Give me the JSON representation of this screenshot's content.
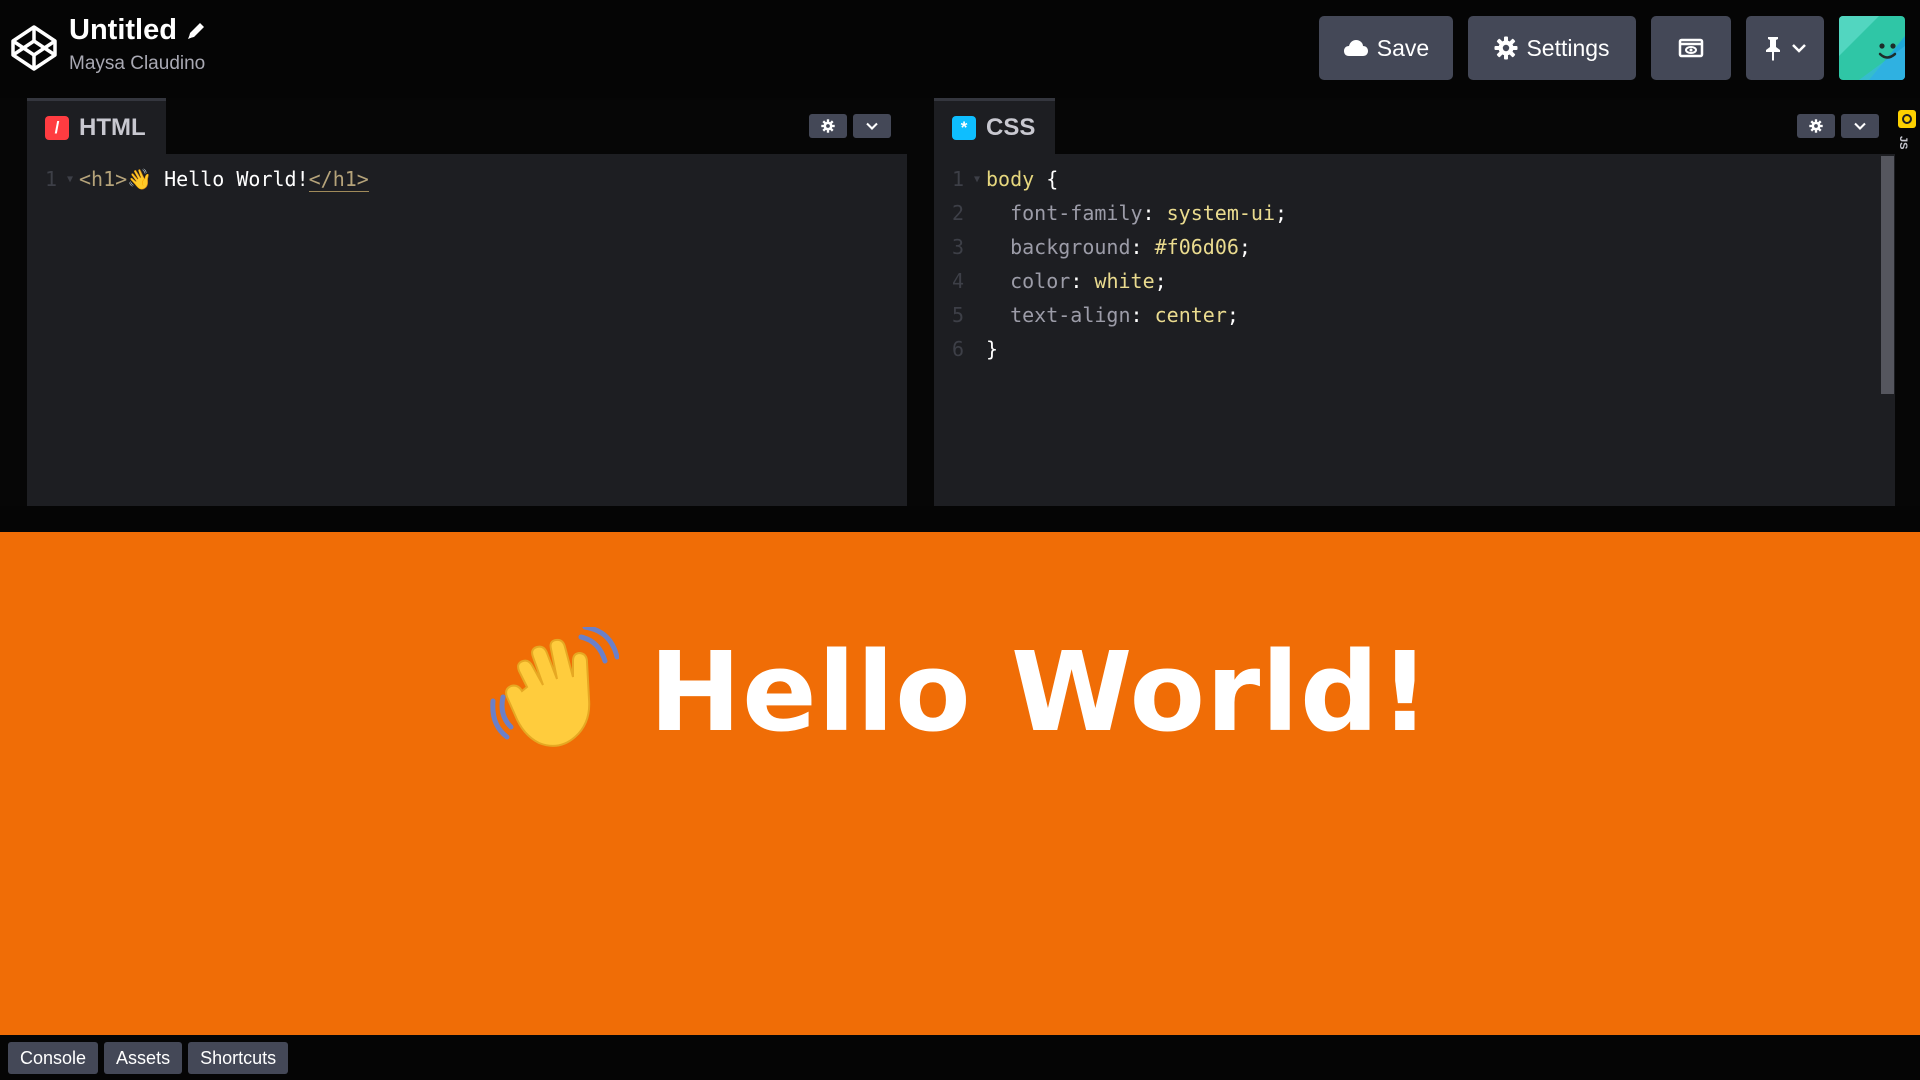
{
  "header": {
    "title": "Untitled",
    "author": "Maysa Claudino",
    "save_label": "Save",
    "settings_label": "Settings"
  },
  "editors": {
    "html": {
      "tab_label": "HTML",
      "lines": [
        {
          "num": "1",
          "open_tag": "<h1>",
          "text": "👋 Hello World!",
          "close_tag": "</h1>"
        }
      ]
    },
    "css": {
      "tab_label": "CSS",
      "lines": [
        {
          "num": "1",
          "selector": "body",
          "brace": " {"
        },
        {
          "num": "2",
          "prop": "font-family",
          "value": "system-ui"
        },
        {
          "num": "3",
          "prop": "background",
          "value": "#f06d06"
        },
        {
          "num": "4",
          "prop": "color",
          "value": "white"
        },
        {
          "num": "5",
          "prop": "text-align",
          "value": "center"
        },
        {
          "num": "6",
          "brace": "}"
        }
      ]
    },
    "js": {
      "tab_label": "JS"
    }
  },
  "preview": {
    "heading": "Hello World!",
    "background": "#f06d06"
  },
  "footer": {
    "console_label": "Console",
    "assets_label": "Assets",
    "shortcuts_label": "Shortcuts"
  },
  "colors": {
    "html_accent": "#ff3c41",
    "css_accent": "#0ebeff",
    "js_accent": "#fcd000",
    "button_bg": "#444857"
  }
}
